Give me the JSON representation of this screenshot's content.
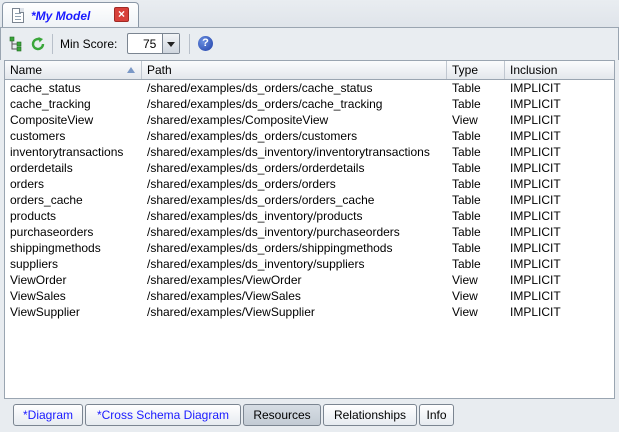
{
  "editor": {
    "tab_title": "*My Model"
  },
  "toolbar": {
    "min_score_label": "Min Score:",
    "min_score_value": "75"
  },
  "table": {
    "columns": [
      "Name",
      "Path",
      "Type",
      "Inclusion"
    ],
    "sort_column": "Name",
    "rows": [
      {
        "name": "cache_status",
        "path": "/shared/examples/ds_orders/cache_status",
        "type": "Table",
        "inclusion": "IMPLICIT"
      },
      {
        "name": "cache_tracking",
        "path": "/shared/examples/ds_orders/cache_tracking",
        "type": "Table",
        "inclusion": "IMPLICIT"
      },
      {
        "name": "CompositeView",
        "path": "/shared/examples/CompositeView",
        "type": "View",
        "inclusion": "IMPLICIT"
      },
      {
        "name": "customers",
        "path": "/shared/examples/ds_orders/customers",
        "type": "Table",
        "inclusion": "IMPLICIT"
      },
      {
        "name": "inventorytransactions",
        "path": "/shared/examples/ds_inventory/inventorytransactions",
        "type": "Table",
        "inclusion": "IMPLICIT"
      },
      {
        "name": "orderdetails",
        "path": "/shared/examples/ds_orders/orderdetails",
        "type": "Table",
        "inclusion": "IMPLICIT"
      },
      {
        "name": "orders",
        "path": "/shared/examples/ds_orders/orders",
        "type": "Table",
        "inclusion": "IMPLICIT"
      },
      {
        "name": "orders_cache",
        "path": "/shared/examples/ds_orders/orders_cache",
        "type": "Table",
        "inclusion": "IMPLICIT"
      },
      {
        "name": "products",
        "path": "/shared/examples/ds_inventory/products",
        "type": "Table",
        "inclusion": "IMPLICIT"
      },
      {
        "name": "purchaseorders",
        "path": "/shared/examples/ds_inventory/purchaseorders",
        "type": "Table",
        "inclusion": "IMPLICIT"
      },
      {
        "name": "shippingmethods",
        "path": "/shared/examples/ds_orders/shippingmethods",
        "type": "Table",
        "inclusion": "IMPLICIT"
      },
      {
        "name": "suppliers",
        "path": "/shared/examples/ds_inventory/suppliers",
        "type": "Table",
        "inclusion": "IMPLICIT"
      },
      {
        "name": "ViewOrder",
        "path": "/shared/examples/ViewOrder",
        "type": "View",
        "inclusion": "IMPLICIT"
      },
      {
        "name": "ViewSales",
        "path": "/shared/examples/ViewSales",
        "type": "View",
        "inclusion": "IMPLICIT"
      },
      {
        "name": "ViewSupplier",
        "path": "/shared/examples/ViewSupplier",
        "type": "View",
        "inclusion": "IMPLICIT"
      }
    ]
  },
  "bottom_tabs": [
    {
      "label": "*Diagram",
      "dirty": true,
      "active": false
    },
    {
      "label": "*Cross Schema Diagram",
      "dirty": true,
      "active": false
    },
    {
      "label": "Resources",
      "dirty": false,
      "active": true
    },
    {
      "label": "Relationships",
      "dirty": false,
      "active": false
    },
    {
      "label": "Info",
      "dirty": false,
      "active": false
    }
  ],
  "colors": {
    "dirty_text": "#1a1aff",
    "close_button": "#d8403a",
    "help_icon": "#1f3fa8"
  },
  "icons": [
    "document-icon",
    "close-icon",
    "tree-icon",
    "refresh-icon",
    "chevron-down-icon",
    "help-icon",
    "sort-ascending-icon"
  ]
}
